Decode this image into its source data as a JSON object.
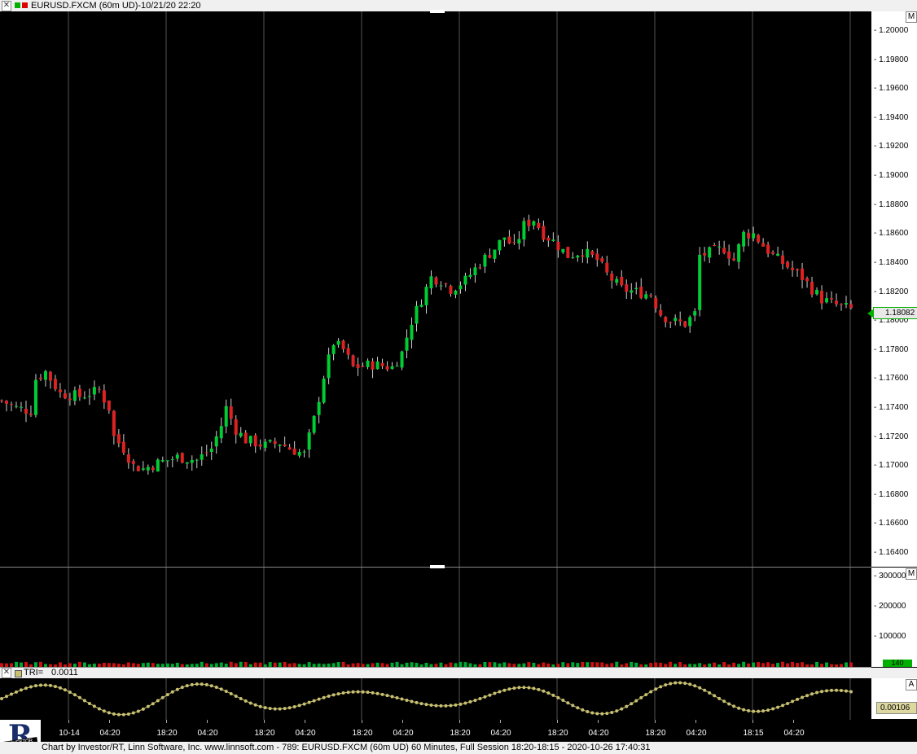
{
  "window": {
    "close_glyph": "✕",
    "title": "EURUSD.FXCM (60m UD)-10/21/20 22:20"
  },
  "price_panel": {
    "scale_button": "M",
    "y_ticks": [
      "1.20000",
      "1.19800",
      "1.19600",
      "1.19400",
      "1.19200",
      "1.19000",
      "1.18800",
      "1.18600",
      "1.18400",
      "1.18200",
      "1.18000",
      "1.17800",
      "1.17600",
      "1.17400",
      "1.17200",
      "1.17000",
      "1.16800",
      "1.16600",
      "1.16400"
    ],
    "last_price": "1.18082",
    "last_price_color": "#00c000",
    "up_color": "#00cc33",
    "down_color": "#dd2222"
  },
  "volume_panel": {
    "scale_button": "M",
    "y_ticks": [
      "300000",
      "200000",
      "100000"
    ],
    "last_badge": "140"
  },
  "tri_panel": {
    "label": "TRI=",
    "value": "0.0011",
    "scale_button": "A",
    "last_value": "0.00106",
    "line_color": "#c8c070"
  },
  "x_axis": {
    "ticks": [
      "10-14",
      "04:20",
      "18:20",
      "04:20",
      "18:20",
      "04:20",
      "18:20",
      "04:20",
      "18:20",
      "04:20",
      "18:20",
      "04:20",
      "18:20",
      "04:20",
      "18:15",
      "04:20"
    ]
  },
  "status": {
    "text": "Chart by Investor/RT, Linn Software, Inc. www.linnsoft.com - 789: EURUSD.FXCM (60m UD) 60 Minutes, Full Session 18:20-18:15 - 2020-10-26 17:40:31"
  },
  "logo": {
    "letter": "R",
    "caption": "INVESTOR"
  },
  "chart_data": {
    "type": "candlestick",
    "title": "EURUSD.FXCM (60m UD)",
    "ylim": [
      1.163,
      1.201
    ],
    "x_ticks": [
      "10-14",
      "04:20",
      "18:20",
      "04:20",
      "18:20",
      "04:20",
      "18:20",
      "04:20",
      "18:20",
      "04:20",
      "18:20",
      "04:20",
      "18:20",
      "04:20",
      "18:15"
    ],
    "close_path": [
      [
        0,
        1.1745
      ],
      [
        3,
        1.174
      ],
      [
        6,
        1.1738
      ],
      [
        7,
        1.176
      ],
      [
        9,
        1.1765
      ],
      [
        12,
        1.175
      ],
      [
        16,
        1.1748
      ],
      [
        20,
        1.1752
      ],
      [
        22,
        1.174
      ],
      [
        23,
        1.172
      ],
      [
        25,
        1.1712
      ],
      [
        27,
        1.17
      ],
      [
        29,
        1.1698
      ],
      [
        32,
        1.1702
      ],
      [
        36,
        1.1706
      ],
      [
        40,
        1.1704
      ],
      [
        43,
        1.1712
      ],
      [
        45,
        1.1728
      ],
      [
        46,
        1.174
      ],
      [
        48,
        1.1725
      ],
      [
        50,
        1.1718
      ],
      [
        54,
        1.1714
      ],
      [
        57,
        1.1716
      ],
      [
        59,
        1.1712
      ],
      [
        62,
        1.1708
      ],
      [
        64,
        1.1732
      ],
      [
        66,
        1.1762
      ],
      [
        68,
        1.1785
      ],
      [
        70,
        1.178
      ],
      [
        72,
        1.1768
      ],
      [
        76,
        1.177
      ],
      [
        80,
        1.1768
      ],
      [
        82,
        1.1778
      ],
      [
        84,
        1.18
      ],
      [
        86,
        1.1815
      ],
      [
        88,
        1.183
      ],
      [
        90,
        1.1828
      ],
      [
        92,
        1.1822
      ],
      [
        95,
        1.1828
      ],
      [
        98,
        1.184
      ],
      [
        101,
        1.185
      ],
      [
        103,
        1.1858
      ],
      [
        105,
        1.185
      ],
      [
        107,
        1.1866
      ],
      [
        109,
        1.187
      ],
      [
        111,
        1.186
      ],
      [
        113,
        1.1855
      ],
      [
        116,
        1.1845
      ],
      [
        119,
        1.1848
      ],
      [
        122,
        1.1842
      ],
      [
        124,
        1.1832
      ],
      [
        127,
        1.1822
      ],
      [
        130,
        1.182
      ],
      [
        133,
        1.1818
      ],
      [
        135,
        1.1805
      ],
      [
        137,
        1.18
      ],
      [
        140,
        1.1798
      ],
      [
        142,
        1.1805
      ],
      [
        143,
        1.1845
      ],
      [
        146,
        1.1848
      ],
      [
        148,
        1.185
      ],
      [
        150,
        1.1842
      ],
      [
        152,
        1.186
      ],
      [
        154,
        1.186
      ],
      [
        156,
        1.1852
      ],
      [
        158,
        1.1845
      ],
      [
        160,
        1.184
      ],
      [
        162,
        1.1835
      ],
      [
        164,
        1.183
      ],
      [
        166,
        1.1822
      ],
      [
        168,
        1.1815
      ],
      [
        170,
        1.1812
      ],
      [
        172,
        1.181
      ],
      [
        174,
        1.1808
      ]
    ],
    "volume_ylim": [
      0,
      330000
    ],
    "volume_ticks": [
      300000,
      200000,
      100000
    ],
    "tri_series_name": "TRI"
  }
}
